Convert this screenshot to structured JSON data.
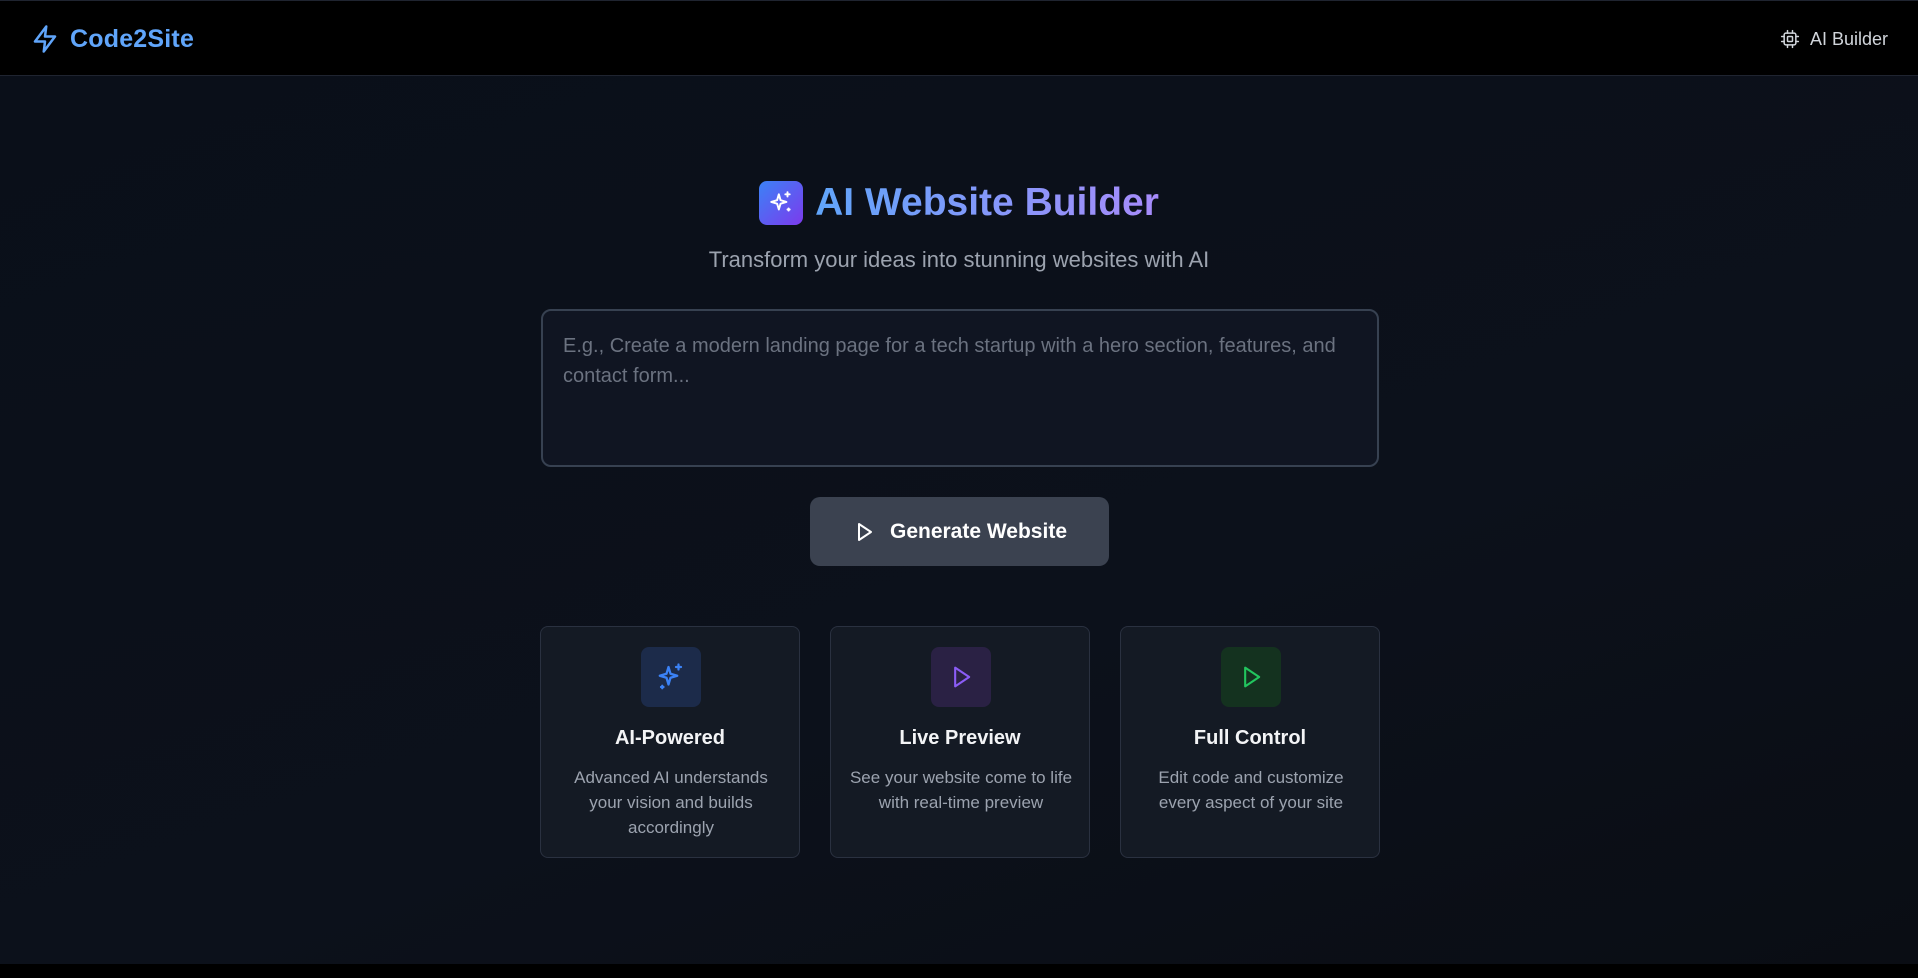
{
  "header": {
    "brand_name": "Code2Site",
    "brand_icon": "lightning-bolt-icon",
    "nav_label": "AI Builder",
    "nav_icon": "chip-icon"
  },
  "hero": {
    "title": "AI Website Builder",
    "badge_icon": "sparkles-icon",
    "subtitle": "Transform your ideas into stunning websites with AI"
  },
  "prompt": {
    "value": "",
    "placeholder": "E.g., Create a modern landing page for a tech startup with a hero section, features, and contact form..."
  },
  "generate_button": {
    "label": "Generate Website",
    "icon": "play-icon"
  },
  "features": [
    {
      "title": "AI-Powered",
      "description": "Advanced AI understands your vision and builds accordingly",
      "icon": "sparkles-icon",
      "color": "#3b82f6"
    },
    {
      "title": "Live Preview",
      "description": "See your website come to life with real-time preview",
      "icon": "play-icon",
      "color": "#8b5cf6"
    },
    {
      "title": "Full Control",
      "description": "Edit code and customize every aspect of your site",
      "icon": "play-icon",
      "color": "#22c55e"
    }
  ],
  "colors": {
    "accent_blue": "#60a5fa",
    "accent_purple": "#a78bfa",
    "background": "#0b0f17",
    "button": "#3b4250"
  }
}
